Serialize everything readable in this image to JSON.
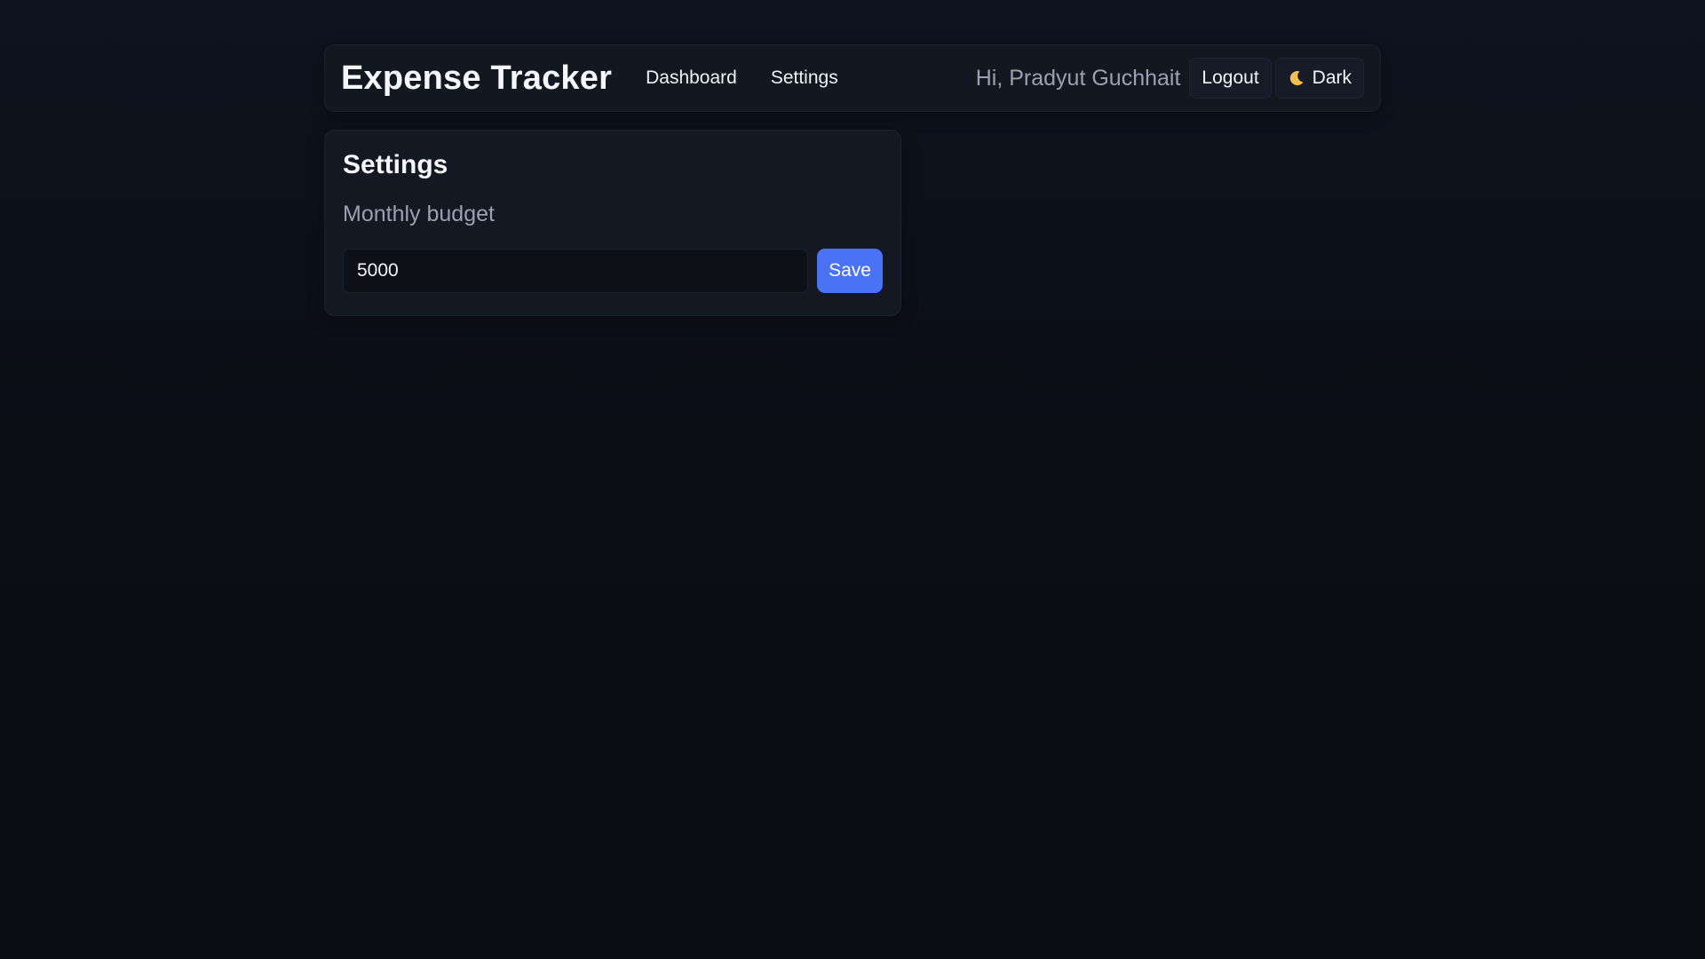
{
  "header": {
    "brand": "Expense Tracker",
    "nav": {
      "dashboard": "Dashboard",
      "settings": "Settings"
    },
    "greeting": "Hi, Pradyut Guchhait",
    "logout_label": "Logout",
    "theme_toggle": {
      "icon": "moon-icon",
      "label": "Dark"
    }
  },
  "settings_card": {
    "title": "Settings",
    "budget_label": "Monthly budget",
    "budget_value": "5000",
    "save_label": "Save"
  },
  "colors": {
    "accent": "#4a72f5",
    "moon": "#f3c14b"
  }
}
